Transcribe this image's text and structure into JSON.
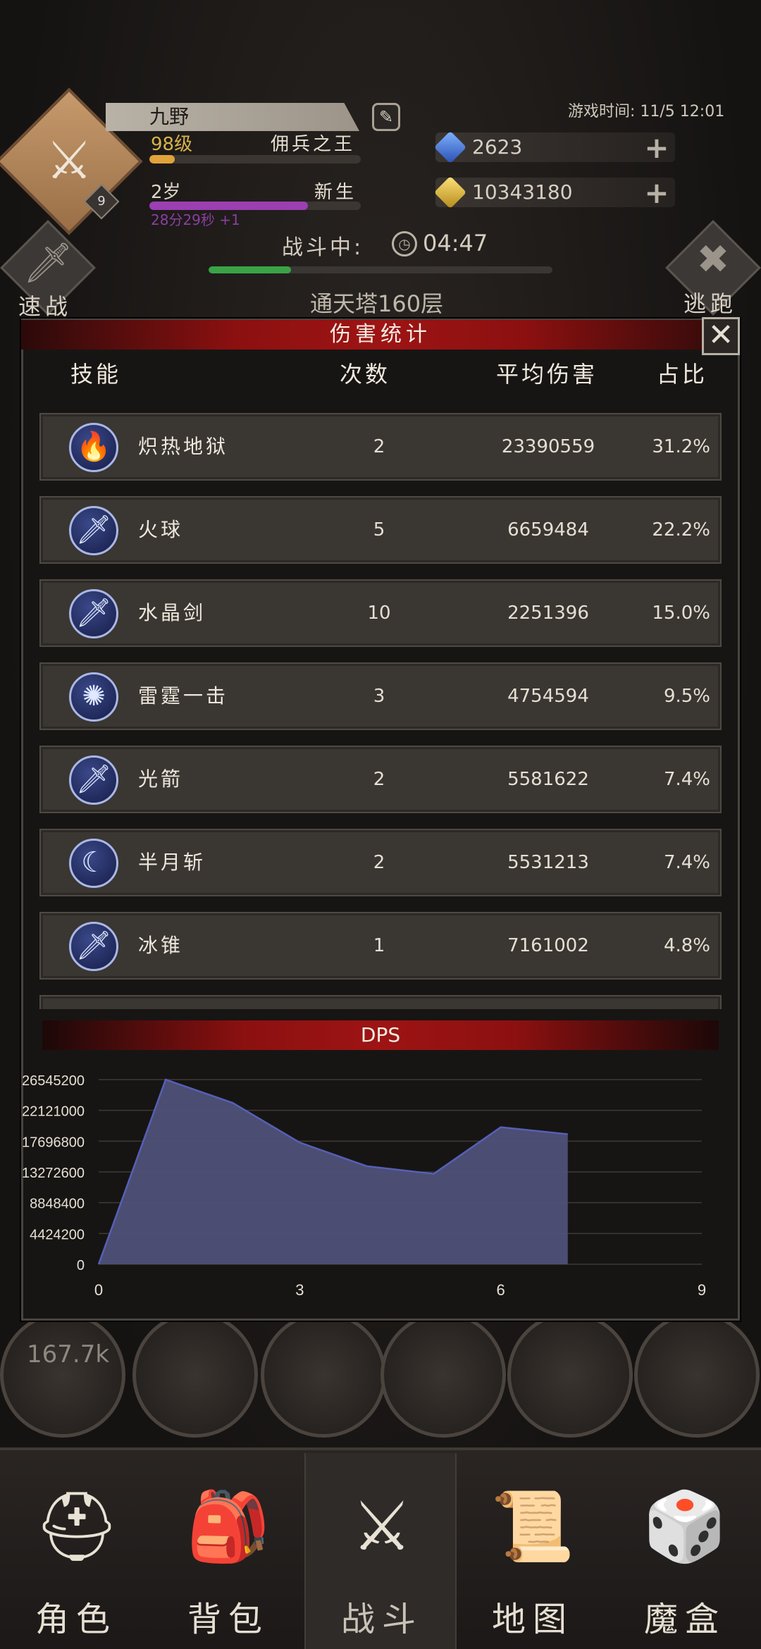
{
  "player": {
    "name": "九野",
    "level": "98级",
    "title": "佣兵之王",
    "age": "2岁",
    "age_title": "新生",
    "age_timer": "28分29秒 +1",
    "level_progress": 0.12,
    "age_progress": 0.75
  },
  "game_time": "游戏时间: 11/5 12:01",
  "resources": {
    "gems": "2623",
    "gold": "10343180"
  },
  "battle": {
    "status_label": "战斗中:",
    "timer": "04:47",
    "progress": 0.24,
    "floor": "通天塔160层"
  },
  "side_buttons": {
    "quick_battle": "速战",
    "escape": "逃跑"
  },
  "modal": {
    "title": "伤害统计",
    "columns": {
      "skill": "技能",
      "count": "次数",
      "avg": "平均伤害",
      "pct": "占比"
    },
    "rows": [
      {
        "icon": "blue-flame-icon",
        "name": "炽热地狱",
        "count": "2",
        "avg": "23390559",
        "pct": "31.2%"
      },
      {
        "icon": "sword-icon",
        "name": "火球",
        "count": "5",
        "avg": "6659484",
        "pct": "22.2%"
      },
      {
        "icon": "sword-icon",
        "name": "水晶剑",
        "count": "10",
        "avg": "2251396",
        "pct": "15.0%"
      },
      {
        "icon": "thunder-orb-icon",
        "name": "雷霆一击",
        "count": "3",
        "avg": "4754594",
        "pct": "9.5%"
      },
      {
        "icon": "sword-icon",
        "name": "光箭",
        "count": "2",
        "avg": "5581622",
        "pct": "7.4%"
      },
      {
        "icon": "crescent-moon-icon",
        "name": "半月斩",
        "count": "2",
        "avg": "5531213",
        "pct": "7.4%"
      },
      {
        "icon": "sword-icon",
        "name": "冰锥",
        "count": "1",
        "avg": "7161002",
        "pct": "4.8%"
      }
    ]
  },
  "behind": {
    "dps_orb": "167.7k"
  },
  "chart_data": {
    "type": "area",
    "title": "DPS",
    "xlabel": "",
    "ylabel": "",
    "x": [
      0,
      1,
      2,
      3,
      4,
      5,
      6,
      7
    ],
    "series": [
      {
        "values": [
          0,
          26545200,
          23200000,
          17500000,
          14100000,
          13000000,
          19700000,
          18700000
        ]
      }
    ],
    "xlim": [
      0,
      9
    ],
    "ylim": [
      0,
      26545200
    ],
    "xticks": [
      "0",
      "3",
      "6",
      "9"
    ],
    "yticks": [
      "0",
      "4424200",
      "8848400",
      "13272600",
      "17696800",
      "22121000",
      "26545200"
    ],
    "fill_color": "#4f5078",
    "line_color": "#5560b8",
    "grid": true
  },
  "nav": [
    {
      "label": "角色",
      "icon": "helmet-icon",
      "active": false
    },
    {
      "label": "背包",
      "icon": "backpack-icon",
      "active": false
    },
    {
      "label": "战斗",
      "icon": "sword-shield-icon",
      "active": true
    },
    {
      "label": "地图",
      "icon": "scroll-map-icon",
      "active": false
    },
    {
      "label": "魔盒",
      "icon": "magic-box-icon",
      "active": false
    }
  ],
  "colors": {
    "modal_header": "#9e1414",
    "level_bar": "#e0a23a",
    "age_bar": "#9b3fb2",
    "battle_progress": "#3aa346"
  }
}
